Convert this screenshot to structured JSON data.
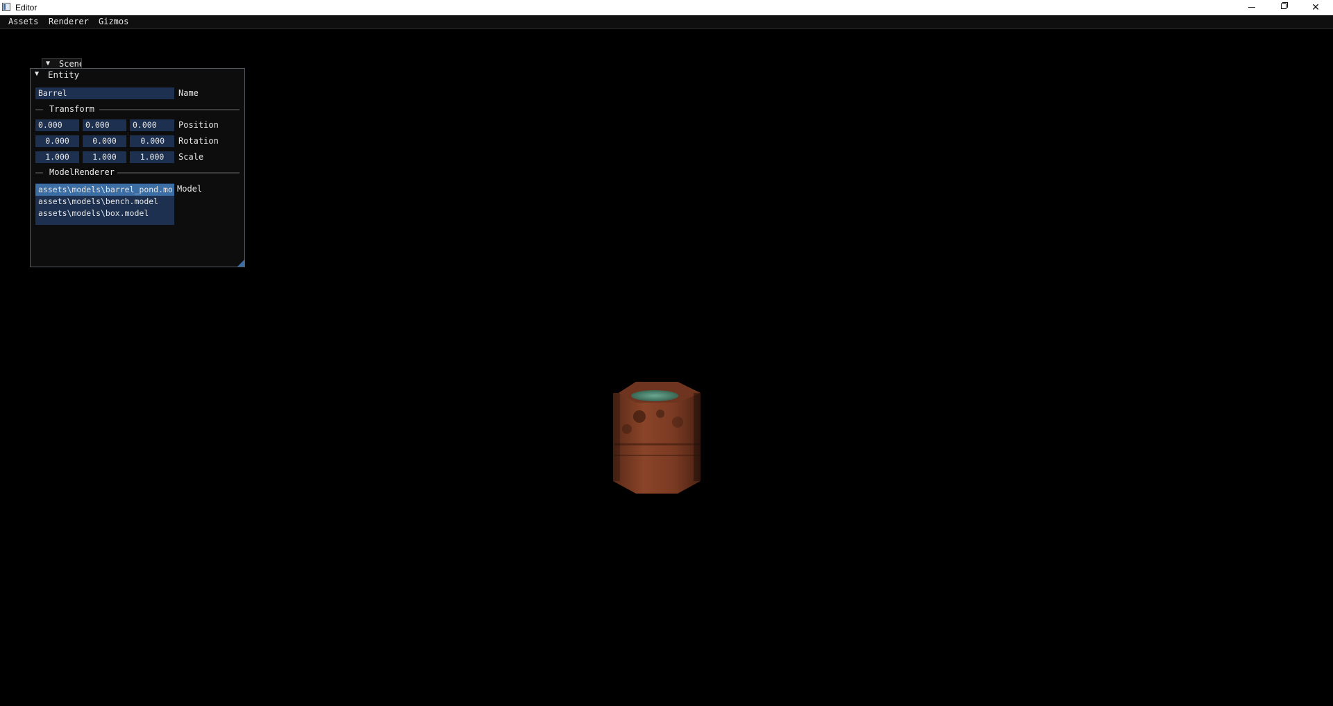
{
  "window": {
    "title": "Editor",
    "controls": [
      "minimize",
      "restore",
      "close"
    ]
  },
  "menubar": {
    "items": [
      {
        "label": "Assets"
      },
      {
        "label": "Renderer"
      },
      {
        "label": "Gizmos"
      }
    ]
  },
  "scene_window": {
    "label": "Scene"
  },
  "entity_window": {
    "header": "Entity",
    "name_value": "Barrel",
    "name_label": "Name",
    "transform_label": "Transform",
    "position": {
      "label": "Position",
      "values": [
        "0.000",
        "0.000",
        "0.000"
      ]
    },
    "rotation": {
      "label": "Rotation",
      "values": [
        "0.000",
        "0.000",
        "0.000"
      ]
    },
    "scale": {
      "label": "Scale",
      "values": [
        "1.000",
        "1.000",
        "1.000"
      ]
    },
    "model_renderer_label": "ModelRenderer",
    "model_label": "Model",
    "models": [
      {
        "label": "assets\\models\\barrel_pond.mo",
        "selected": true
      },
      {
        "label": "assets\\models\\bench.model",
        "selected": false
      },
      {
        "label": "assets\\models\\box.model",
        "selected": false
      }
    ]
  },
  "viewport": {
    "object": "barrel-model"
  },
  "colors": {
    "background": "#000000",
    "field_bg": "#1d3050",
    "selection": "#3b6ea5",
    "barrel_rust": "#7a3b22",
    "water": "#4e8a74"
  }
}
